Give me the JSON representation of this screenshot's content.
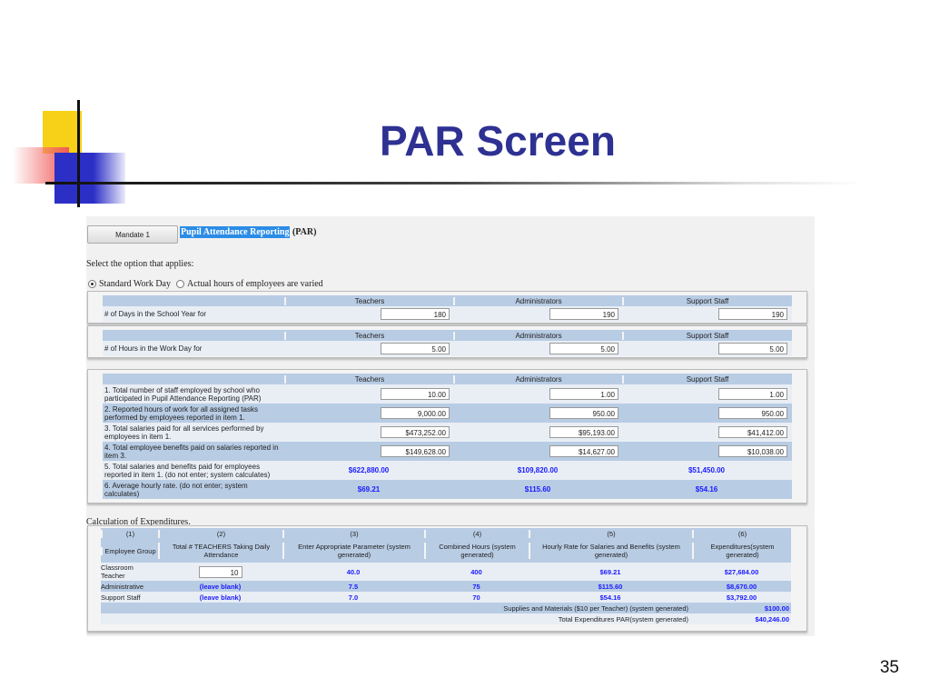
{
  "slide": {
    "title": "PAR Screen",
    "page_number": "35"
  },
  "app": {
    "mandate_button": "Mandate 1",
    "title_highlight": "Pupil Attendance Reporting",
    "title_suffix": "(PAR)",
    "select_prompt": "Select the option that applies:",
    "radio_options": [
      {
        "label": "Standard Work Day",
        "selected": true
      },
      {
        "label": "Actual hours of employees are varied",
        "selected": false
      }
    ],
    "columns": [
      "Teachers",
      "Administrators",
      "Support Staff"
    ],
    "days_row": {
      "label": "# of Days in the School Year for",
      "values": [
        "180",
        "190",
        "190"
      ]
    },
    "hours_row": {
      "label": "# of Hours in the Work Day for",
      "values": [
        "5.00",
        "5.00",
        "5.00"
      ]
    },
    "staff_rows": [
      {
        "label": "1. Total number of staff employed by school who participated in Pupil Attendance Reporting (PAR)",
        "values": [
          "10.00",
          "1.00",
          "1.00"
        ]
      },
      {
        "label": "2. Reported hours of work for all assigned tasks performed by employees reported in item 1.",
        "values": [
          "9,000.00",
          "950.00",
          "950.00"
        ]
      },
      {
        "label": "3. Total salaries paid for all services performed by employees in item 1.",
        "values": [
          "$473,252.00",
          "$95,193.00",
          "$41,412.00"
        ]
      },
      {
        "label": "4. Total employee benefits paid on salaries reported in item 3.",
        "values": [
          "$149,628.00",
          "$14,627.00",
          "$10,038.00"
        ]
      },
      {
        "label": "5. Total salaries and benefits paid for employees reported in item 1. (do not enter; system calculates)",
        "values": [
          "$622,880.00",
          "$109,820.00",
          "$51,450.00"
        ]
      },
      {
        "label": "6. Average hourly rate. (do not enter; system calculates)",
        "values": [
          "$69.21",
          "$115.60",
          "$54.16"
        ]
      }
    ],
    "calc_title": "Calculation of Expenditures.",
    "exp_col_numbers": [
      "(1)",
      "(2)",
      "(3)",
      "(4)",
      "(5)",
      "(6)"
    ],
    "exp_headers": [
      "Employee Group",
      "Total # TEACHERS Taking Daily Attendance",
      "Enter Appropriate Parameter (system generated)",
      "Combined Hours (system generated)",
      "Hourly Rate for Salaries and Benefits (system generated)",
      "Expenditures(system generated)"
    ],
    "exp_rows": [
      {
        "group": "Classroom Teacher",
        "count": "10",
        "param": "40.0",
        "hours": "400",
        "rate": "$69.21",
        "expenditure": "$27,684.00"
      },
      {
        "group": "Administrative",
        "count": "(leave blank)",
        "param": "7.5",
        "hours": "75",
        "rate": "$115.60",
        "expenditure": "$8,670.00"
      },
      {
        "group": "Support Staff",
        "count": "(leave blank)",
        "param": "7.0",
        "hours": "70",
        "rate": "$54.16",
        "expenditure": "$3,792.00"
      }
    ],
    "supplies": {
      "label": "Supplies and Materials ($10 per Teacher) (system generated)",
      "value": "$100.00"
    },
    "total": {
      "label": "Total Expenditures PAR(system generated)",
      "value": "$40,246.00"
    }
  }
}
